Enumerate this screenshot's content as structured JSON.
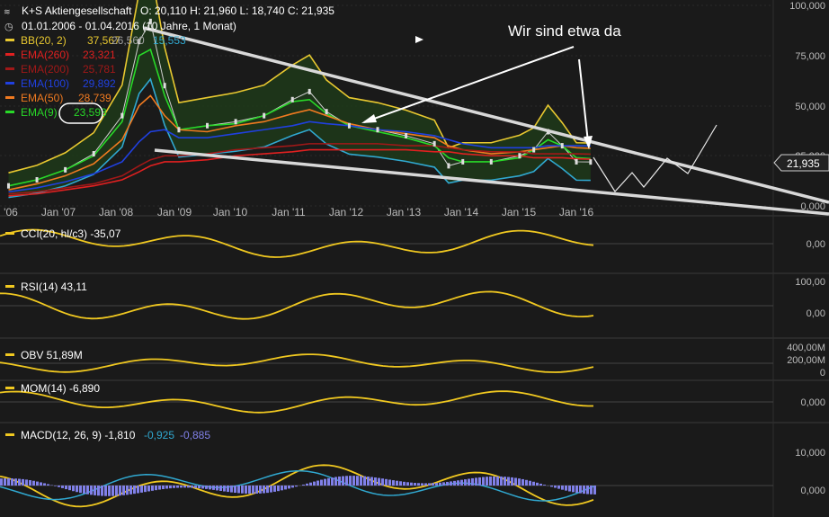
{
  "header": {
    "instrument": "K+S Aktiengesellschaft",
    "ohlc": "O: 20,110   H: 21,960   L: 18,740   C: 21,935",
    "range": "01.01.2006 - 01.04.2016 (10 Jahre, 1 Monat)"
  },
  "legend": [
    {
      "label": "BB(20, 2)",
      "value": "37,567",
      "extra1": "26,560",
      "extra2": "15,553",
      "color": "#e8c830"
    },
    {
      "label": "EMA(260)",
      "value": "23,321",
      "color": "#e02020"
    },
    {
      "label": "EMA(200)",
      "value": "25,781",
      "color": "#a01818"
    },
    {
      "label": "EMA(100)",
      "value": "29,892",
      "color": "#2040e0"
    },
    {
      "label": "EMA(50)",
      "value": "28,739",
      "color": "#f07a20"
    },
    {
      "label": "EMA(9)",
      "value": "23,593",
      "color": "#28d828"
    }
  ],
  "annotation": "Wir sind etwa da",
  "price_badge": "21,935",
  "main_axis": {
    "ticks": [
      "100,000",
      "75,000",
      "50,000",
      "25,000",
      "0,000"
    ]
  },
  "x_axis": {
    "ticks": [
      "'06",
      "Jan '07",
      "Jan '08",
      "Jan '09",
      "Jan '10",
      "Jan '11",
      "Jan '12",
      "Jan '13",
      "Jan '14",
      "Jan '15",
      "Jan '16"
    ]
  },
  "panels": [
    {
      "id": "cci",
      "label": "CCI(20, hl/c3)",
      "value": "-35,07",
      "ticks": [
        "0,00"
      ]
    },
    {
      "id": "rsi",
      "label": "RSI(14)",
      "value": "43,11",
      "ticks": [
        "100,00",
        "0,00"
      ]
    },
    {
      "id": "obv",
      "label": "OBV",
      "value": "51,89M",
      "ticks": [
        "400,00M",
        "200,00M",
        "0"
      ]
    },
    {
      "id": "mom",
      "label": "MOM(14)",
      "value": "-6,890",
      "ticks": [
        "0,000"
      ]
    },
    {
      "id": "macd",
      "label": "MACD(12, 26, 9)",
      "value": "-1,810",
      "value2": "-0,925",
      "value3": "-0,885",
      "ticks": [
        "10,000",
        "0,000"
      ]
    }
  ],
  "chart_data": {
    "type": "line",
    "x": [
      2006.0,
      2006.5,
      2007.0,
      2007.5,
      2008.0,
      2008.3,
      2008.5,
      2008.75,
      2009.0,
      2009.5,
      2010.0,
      2010.5,
      2011.0,
      2011.3,
      2011.6,
      2012.0,
      2012.5,
      2013.0,
      2013.5,
      2013.75,
      2014.0,
      2014.5,
      2015.0,
      2015.25,
      2015.5,
      2015.75,
      2016.0,
      2016.25
    ],
    "series": [
      {
        "name": "K+S Aktiengesellschaft",
        "values": [
          10,
          13,
          18,
          26,
          45,
          82,
          92,
          60,
          38,
          40,
          42,
          45,
          53,
          57,
          47,
          40,
          38,
          35,
          31,
          20,
          22,
          22,
          25,
          28,
          37,
          30,
          22,
          21.9
        ]
      },
      {
        "name": "EMA(9)",
        "values": [
          10,
          13,
          18,
          25,
          42,
          75,
          78,
          55,
          38,
          40,
          41,
          45,
          52,
          53,
          46,
          40,
          37,
          34,
          30,
          24,
          22,
          22,
          24,
          28,
          33,
          30,
          24,
          23.6
        ]
      },
      {
        "name": "EMA(50)",
        "values": [
          8,
          11,
          15,
          21,
          33,
          50,
          55,
          45,
          38,
          37,
          40,
          42,
          46,
          48,
          45,
          41,
          38,
          36,
          34,
          30,
          28,
          26,
          27,
          28,
          29,
          30,
          29,
          28.7
        ]
      },
      {
        "name": "EMA(100)",
        "values": [
          7,
          9,
          12,
          16,
          22,
          32,
          37,
          38,
          34,
          34,
          36,
          38,
          40,
          42,
          41,
          40,
          38,
          37,
          35,
          33,
          31,
          29,
          29,
          29,
          30,
          30,
          30,
          29.9
        ]
      },
      {
        "name": "EMA(200)",
        "values": [
          6,
          7,
          9,
          11,
          15,
          20,
          23,
          25,
          25,
          26,
          28,
          29,
          30,
          31,
          31,
          31,
          31,
          30,
          30,
          29,
          28,
          27,
          27,
          26,
          26,
          26,
          26,
          25.8
        ]
      },
      {
        "name": "EMA(260)",
        "values": [
          5,
          6,
          8,
          10,
          13,
          17,
          20,
          22,
          22,
          23,
          25,
          26,
          27,
          28,
          28,
          28,
          28,
          28,
          27,
          27,
          26,
          25,
          25,
          24,
          24,
          24,
          23.5,
          23.3
        ]
      }
    ],
    "ylim": [
      0,
      100
    ],
    "xlim": [
      2005.85,
      2016.3
    ]
  }
}
